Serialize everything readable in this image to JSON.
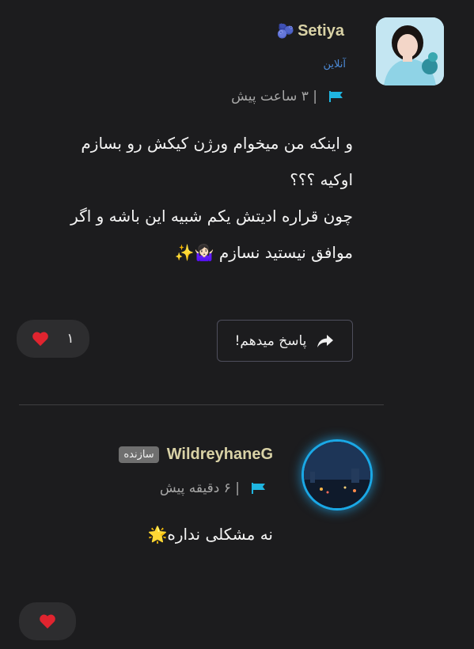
{
  "comments": [
    {
      "username": "Setiya",
      "username_emoji": "🫐",
      "status": "آنلاین",
      "time": "| ۳ ساعت پیش",
      "lines": [
        "و اینکه من میخوام ورژن کیکش رو بسازم",
        "اوکیه ؟؟؟",
        "چون قراره ادیتش یکم شبیه این باشه و اگر",
        "موافق نیستید نسازم 🤷🏻‍♀️✨"
      ],
      "like_count": "۱",
      "reply_label": "پاسخ میدهم!"
    },
    {
      "username": "WildreyhaneG",
      "badge": "سازنده",
      "time": "| ۶ دقیقه پیش",
      "lines": [
        "نه مشکلی نداره🌟"
      ]
    }
  ],
  "colors": {
    "background": "#1c1c1e",
    "username": "#d9d2a6",
    "flag": "#1fb5e0",
    "online": "#4c8bd8",
    "heart": "#e0242f",
    "avatar_ring": "#1aa8e6"
  },
  "icons": {
    "flag": "flag-icon",
    "heart": "heart-icon",
    "reply": "reply-arrow-icon"
  }
}
